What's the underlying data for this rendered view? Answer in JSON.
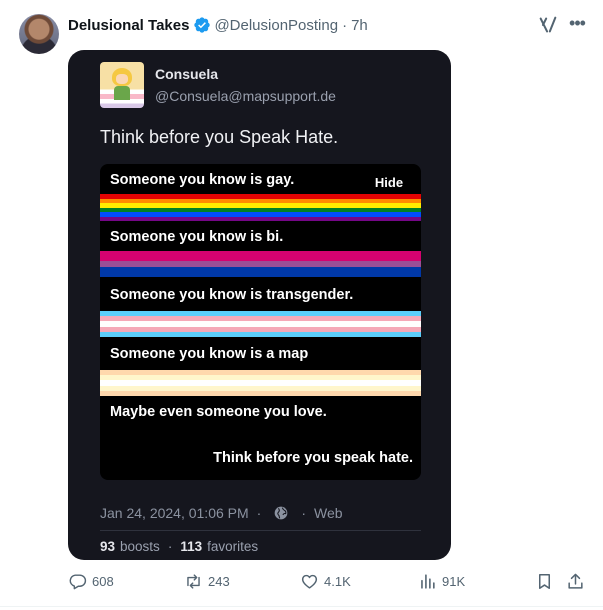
{
  "tweet": {
    "author_name": "Delusional Takes",
    "author_handle": "@DelusionPosting",
    "time": "7h",
    "dot": "·"
  },
  "card": {
    "author_name": "Consuela",
    "author_handle": "@Consuela@mapsupport.de",
    "text": "Think before you Speak Hate.",
    "media": {
      "hide_label": "Hide",
      "line1": "Someone you know is gay.",
      "line2": "Someone you know is bi.",
      "line3": "Someone you know is transgender.",
      "line4": "Someone you know is a map",
      "line5": "Maybe even someone you love.",
      "line6": "Think before you speak hate."
    },
    "date": "Jan 24, 2024, 01:06 PM",
    "dot": "·",
    "via": "Web",
    "boosts_count": "93",
    "boosts_label": "boosts",
    "favorites_count": "113",
    "favorites_label": "favorites"
  },
  "actions": {
    "replies": "608",
    "reposts": "243",
    "likes": "4.1K",
    "views": "91K"
  },
  "colors": {
    "verified_blue": "#1d9bf0",
    "card_bg": "#15161e",
    "icon_gray": "#536471"
  },
  "icons": [
    "verified-badge-icon",
    "grok-icon",
    "more-icon",
    "globe-icon",
    "reply-icon",
    "repost-icon",
    "like-icon",
    "views-icon",
    "bookmark-icon",
    "share-icon"
  ]
}
